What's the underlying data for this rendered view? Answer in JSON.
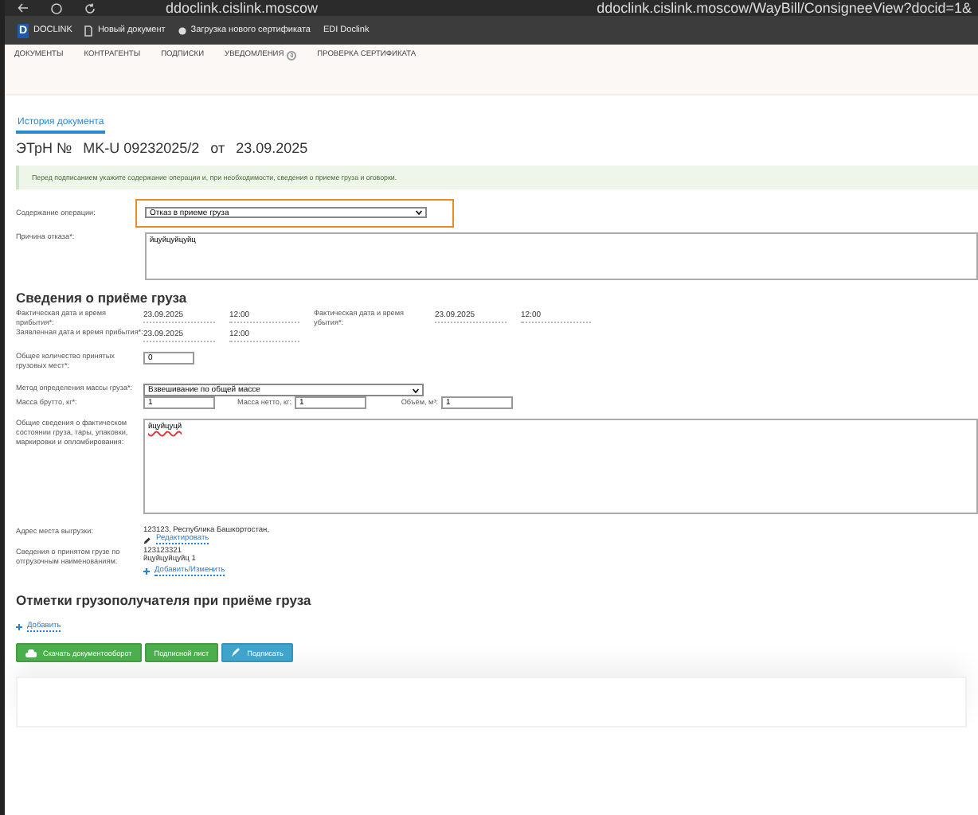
{
  "browser": {
    "url": "ddoclink.cislink.moscow",
    "url_full": "ddoclink.cislink.moscow/WayBill/ConsigneeView?docid=1&"
  },
  "bookmarks": [
    {
      "kind": "logo",
      "letter": "D",
      "label": "DOCLINK"
    },
    {
      "kind": "page",
      "label": "Новый документ"
    },
    {
      "kind": "dot",
      "label": "Загрузка нового сертификата"
    },
    {
      "kind": "plain",
      "label": "EDI Doclink"
    }
  ],
  "nav": [
    {
      "label": "ДОКУМЕНТЫ"
    },
    {
      "label": "КОНТРАГЕНТЫ"
    },
    {
      "label": "ПОДПИСКИ"
    },
    {
      "label": "УВЕДОМЛЕНИЯ",
      "badge": "0"
    },
    {
      "label": "ПРОВЕРКА СЕРТИФИКАТА"
    }
  ],
  "tabs": [
    {
      "label": "История документа",
      "selected": true
    }
  ],
  "title": {
    "doc_type": "ЭТрН №",
    "number": "MK-U 09232025/2",
    "from": "от",
    "date": "23.09.2025"
  },
  "alert": "Перед подписанием укажите содержание операции и, при необходимости, сведения о приеме груза и оговорки.",
  "operation": {
    "label": "Содержание операции:",
    "value": "Отказ в приеме груза",
    "highlighted": true
  },
  "reason": {
    "label": "Причина отказа*:",
    "value": "йцуйцуйцуйц"
  },
  "cargo_section": {
    "heading": "Сведения о приёме груза",
    "actual_arrival": {
      "label": "Фактическая дата и время прибытия*:",
      "date": "23.09.2025",
      "time": "12:00"
    },
    "actual_departure": {
      "label": "Фактическая дата и время убытия*:",
      "date": "23.09.2025",
      "time": "12:00"
    },
    "declared_arrival": {
      "label": "Заявленная дата и время прибытия*:",
      "date": "23.09.2025",
      "time": "12:00"
    },
    "places": {
      "label": "Общее количество принятых грузовых мест*:",
      "value": "0"
    },
    "mass_method": {
      "label": "Метод определения массы груза*:",
      "value": "Взвешивание по общей массе"
    },
    "gross": {
      "label": "Масса брутто, кг*:",
      "value": "1"
    },
    "net": {
      "label": "Масса нетто, кг:",
      "value": "1"
    },
    "volume": {
      "label": "Объём, м³:",
      "value": "1"
    },
    "condition": {
      "label": "Общие сведения о фактическом состоянии груза, тары, упаковки, маркировки и опломбирования:",
      "value": "йцуйцуцй"
    },
    "address": {
      "label": "Адрес места выгрузки:",
      "value": "123123, Республика Башкортостан,",
      "link": "Редактировать"
    },
    "accepted": {
      "label": "Сведения о принятом грузе по отгрузочным наименованиям:",
      "lines": [
        "123123321",
        "йцуйцуйцуйц 1"
      ],
      "link": "Добавить/Изменить"
    }
  },
  "marks_section": {
    "heading": "Отметки грузополучателя при приёме груза",
    "link": "Добавить"
  },
  "buttons": [
    {
      "kind": "download",
      "label": "Скачать документооборот"
    },
    {
      "kind": "sheet",
      "label": "Подписной лист"
    },
    {
      "kind": "sign",
      "label": "Подписать"
    }
  ]
}
